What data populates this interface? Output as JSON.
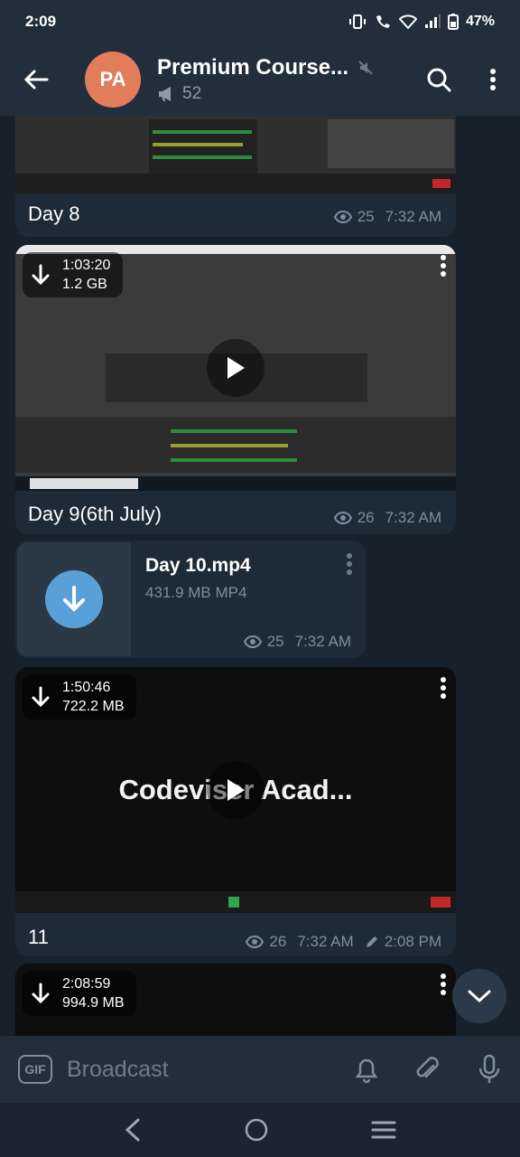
{
  "status_bar": {
    "time": "2:09",
    "battery": "47%"
  },
  "header": {
    "avatar_initials": "PA",
    "title": "Premium Course...",
    "subscriber_count": "52",
    "avatar_color": "#e27d5b"
  },
  "messages": [
    {
      "caption": "Day 8",
      "views": "25",
      "time": "7:32 AM"
    },
    {
      "caption": "Day 9(6th July)",
      "duration": "1:03:20",
      "size": "1.2 GB",
      "views": "26",
      "time": "7:32 AM"
    },
    {
      "file_name": "Day 10.mp4",
      "file_info": "431.9 MB MP4",
      "views": "25",
      "time": "7:32 AM"
    },
    {
      "caption": "11",
      "duration": "1:50:46",
      "size": "722.2 MB",
      "overlay_text": "Codeviser Acad...",
      "views": "26",
      "time": "7:32 AM",
      "edited_time": "2:08 PM"
    },
    {
      "duration": "2:08:59",
      "size": "994.9 MB"
    }
  ],
  "input": {
    "placeholder": "Broadcast",
    "gif_label": "GIF"
  },
  "colors": {
    "background": "#17212b",
    "header": "#232e3c",
    "bubble": "#1d2a38",
    "accent": "#5aa0d8"
  }
}
